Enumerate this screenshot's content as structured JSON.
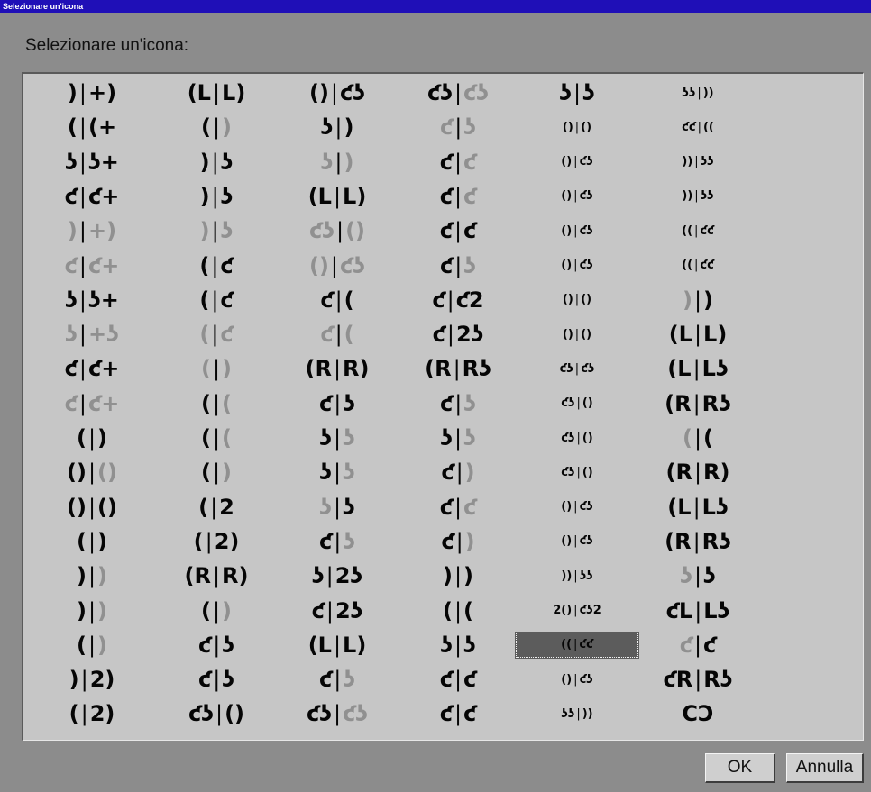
{
  "window": {
    "title": "Selezionare un'icona"
  },
  "dialog": {
    "heading": "Selezionare un'icona:"
  },
  "buttons": {
    "ok": "OK",
    "cancel": "Annulla"
  },
  "colors": {
    "title_bar": "#1f0fb7",
    "panel_background": "#c6c6c6",
    "dialog_background": "#8c8c8c",
    "selected_cell": "#5c5c5c",
    "icon_dark": "#050505",
    "icon_light": "#909090"
  },
  "icon_grid": {
    "columns": 6,
    "rows": 19,
    "selected": {
      "column": 4,
      "row": 16
    },
    "columns_data": [
      [
        {
          "l": ")",
          "r": "+)"
        },
        {
          "l": "(",
          "r": "(+"
        },
        {
          "l": "ʖ",
          "r": "ʖ+"
        },
        {
          "l": "ƈ",
          "r": "ƈ+"
        },
        {
          "l": ")",
          "r": "+)",
          "faint": true
        },
        {
          "l": "ƈ",
          "r": "ƈ+",
          "faint": true
        },
        {
          "l": "ʖ",
          "r": "ʖ+"
        },
        {
          "l": "ʖ",
          "r": "+ʖ",
          "faint": true
        },
        {
          "l": "ƈ",
          "r": "ƈ+"
        },
        {
          "l": "ƈ",
          "r": "ƈ+",
          "faint": true
        },
        {
          "l": "(",
          "r": ")"
        },
        {
          "l": "()",
          "r": "()",
          "rfaint": true
        },
        {
          "l": "()",
          "r": "()"
        },
        {
          "l": "(",
          "r": ")"
        },
        {
          "l": ")",
          "r": ")",
          "rfaint": true
        },
        {
          "l": ")",
          "r": ")",
          "rfaint": true
        },
        {
          "l": "(",
          "r": ")",
          "rfaint": true
        },
        {
          "l": ")",
          "r": "2)"
        },
        {
          "l": "(",
          "r": "2)"
        }
      ],
      [
        {
          "l": "(L",
          "r": "L)"
        },
        {
          "l": "(",
          "r": ")",
          "rfaint": true
        },
        {
          "l": ")",
          "r": "ʖ"
        },
        {
          "l": ")",
          "r": "ʖ"
        },
        {
          "l": ")",
          "r": "ʖ",
          "faint": true
        },
        {
          "l": "(",
          "r": "ƈ"
        },
        {
          "l": "(",
          "r": "ƈ"
        },
        {
          "l": "(",
          "r": "ƈ",
          "faint": true
        },
        {
          "l": "(",
          "r": ")",
          "faint": true
        },
        {
          "l": "(",
          "r": "(",
          "rfaint": true
        },
        {
          "l": "(",
          "r": "(",
          "rfaint": true
        },
        {
          "l": "(",
          "r": ")",
          "rfaint": true
        },
        {
          "l": "(",
          "r": "2"
        },
        {
          "l": "(",
          "r": "2)"
        },
        {
          "l": "(R",
          "r": "R)"
        },
        {
          "l": "(",
          "r": ")",
          "rfaint": true
        },
        {
          "l": "ƈ",
          "r": "ʖ"
        },
        {
          "l": "ƈ",
          "r": "ʖ"
        },
        {
          "l": "ƈʖ",
          "r": "()"
        }
      ],
      [
        {
          "l": "()",
          "r": "ƈʖ"
        },
        {
          "l": "ʖ",
          "r": ")"
        },
        {
          "l": "ʖ",
          "r": ")",
          "faint": true
        },
        {
          "l": "(L",
          "r": "L)"
        },
        {
          "l": "ƈʖ",
          "r": "()",
          "faint": true
        },
        {
          "l": "()",
          "r": "ƈʖ",
          "faint": true
        },
        {
          "l": "ƈ",
          "r": "("
        },
        {
          "l": "ƈ",
          "r": "(",
          "faint": true
        },
        {
          "l": "(R",
          "r": "R)"
        },
        {
          "l": "ƈ",
          "r": "ʖ"
        },
        {
          "l": "ʖ",
          "r": "ʖ",
          "rfaint": true
        },
        {
          "l": "ʖ",
          "r": "ʖ",
          "rfaint": true
        },
        {
          "l": "ʖ",
          "r": "ʖ",
          "lfaint": true
        },
        {
          "l": "ƈ",
          "r": "ʖ",
          "rfaint": true
        },
        {
          "l": "ʖ",
          "r": "2ʖ"
        },
        {
          "l": "ƈ",
          "r": "2ʖ"
        },
        {
          "l": "(L",
          "r": "L)"
        },
        {
          "l": "ƈ",
          "r": "ʖ",
          "rfaint": true
        },
        {
          "l": "ƈʖ",
          "r": "ƈʖ",
          "rfaint": true
        }
      ],
      [
        {
          "l": "ƈʖ",
          "r": "ƈʖ",
          "rfaint": true
        },
        {
          "l": "ƈ",
          "r": "ʖ",
          "faint": true
        },
        {
          "l": "ƈ",
          "r": "ƈ",
          "rfaint": true
        },
        {
          "l": "ƈ",
          "r": "ƈ",
          "rfaint": true
        },
        {
          "l": "ƈ",
          "r": "ƈ"
        },
        {
          "l": "ƈ",
          "r": "ʖ",
          "rfaint": true
        },
        {
          "l": "ƈ",
          "r": "ƈ2"
        },
        {
          "l": "ƈ",
          "r": "2ʖ"
        },
        {
          "l": "(R",
          "r": "Rʖ"
        },
        {
          "l": "ƈ",
          "r": "ʖ",
          "rfaint": true
        },
        {
          "l": "ʖ",
          "r": "ʖ",
          "rfaint": true
        },
        {
          "l": "ƈ",
          "r": ")",
          "rfaint": true
        },
        {
          "l": "ƈ",
          "r": "ƈ",
          "rfaint": true
        },
        {
          "l": "ƈ",
          "r": ")",
          "rfaint": true
        },
        {
          "l": ")",
          "r": ")"
        },
        {
          "l": "(",
          "r": "("
        },
        {
          "l": "ʖ",
          "r": "ʖ"
        },
        {
          "l": "ƈ",
          "r": "ƈ"
        },
        {
          "l": "ƈ",
          "r": "ƈ"
        }
      ],
      [
        {
          "l": "ʖ",
          "r": "ʖ"
        },
        {
          "l": "()",
          "r": "()",
          "small": true
        },
        {
          "l": "()",
          "r": "ƈʖ",
          "small": true
        },
        {
          "l": "()",
          "r": "ƈʖ",
          "small": true
        },
        {
          "l": "()",
          "r": "ƈʖ",
          "small": true
        },
        {
          "l": "()",
          "r": "ƈʖ",
          "small": true
        },
        {
          "l": "()",
          "r": "()",
          "small": true
        },
        {
          "l": "()",
          "r": "()",
          "small": true
        },
        {
          "l": "ƈʖ",
          "r": "ƈʖ",
          "small": true
        },
        {
          "l": "ƈʖ",
          "r": "()",
          "small": true
        },
        {
          "l": "ƈʖ",
          "r": "()",
          "small": true
        },
        {
          "l": "ƈʖ",
          "r": "()",
          "small": true
        },
        {
          "l": "()",
          "r": "ƈʖ",
          "small": true
        },
        {
          "l": "()",
          "r": "ƈʖ",
          "small": true
        },
        {
          "l": "))",
          "r": "ʖʖ",
          "small": true
        },
        {
          "l": "2()",
          "r": "ƈʖ2",
          "small": true
        },
        {
          "l": "((",
          "r": "ƈƈ",
          "small": true
        },
        {
          "l": "()",
          "r": "ƈʖ",
          "small": true
        },
        {
          "l": "ʖʖ",
          "r": "))",
          "small": true
        }
      ],
      [
        {
          "l": "ʖʖ",
          "r": "))",
          "small": true
        },
        {
          "l": "ƈƈ",
          "r": "((",
          "small": true
        },
        {
          "l": "))",
          "r": "ʖʖ",
          "small": true
        },
        {
          "l": "))",
          "r": "ʖʖ",
          "small": true
        },
        {
          "l": "((",
          "r": "ƈƈ",
          "small": true
        },
        {
          "l": "((",
          "r": "ƈƈ",
          "small": true
        },
        {
          "l": ")",
          "r": ")",
          "lfaint": true
        },
        {
          "l": "(L",
          "r": "L)"
        },
        {
          "l": "(L",
          "r": "Lʖ"
        },
        {
          "l": "(R",
          "r": "Rʖ"
        },
        {
          "l": "(",
          "r": "(",
          "lfaint": true
        },
        {
          "l": "(R",
          "r": "R)"
        },
        {
          "l": "(L",
          "r": "Lʖ"
        },
        {
          "l": "(R",
          "r": "Rʖ"
        },
        {
          "l": "ʖ",
          "r": "ʖ",
          "lfaint": true
        },
        {
          "l": "ƈL",
          "r": "Lʖ"
        },
        {
          "l": "ƈ",
          "r": "ƈ",
          "lfaint": true
        },
        {
          "l": "ƈR",
          "r": "Rʖ"
        },
        {
          "l": "C",
          "r": "Ɔ",
          "chain": true
        }
      ]
    ]
  }
}
